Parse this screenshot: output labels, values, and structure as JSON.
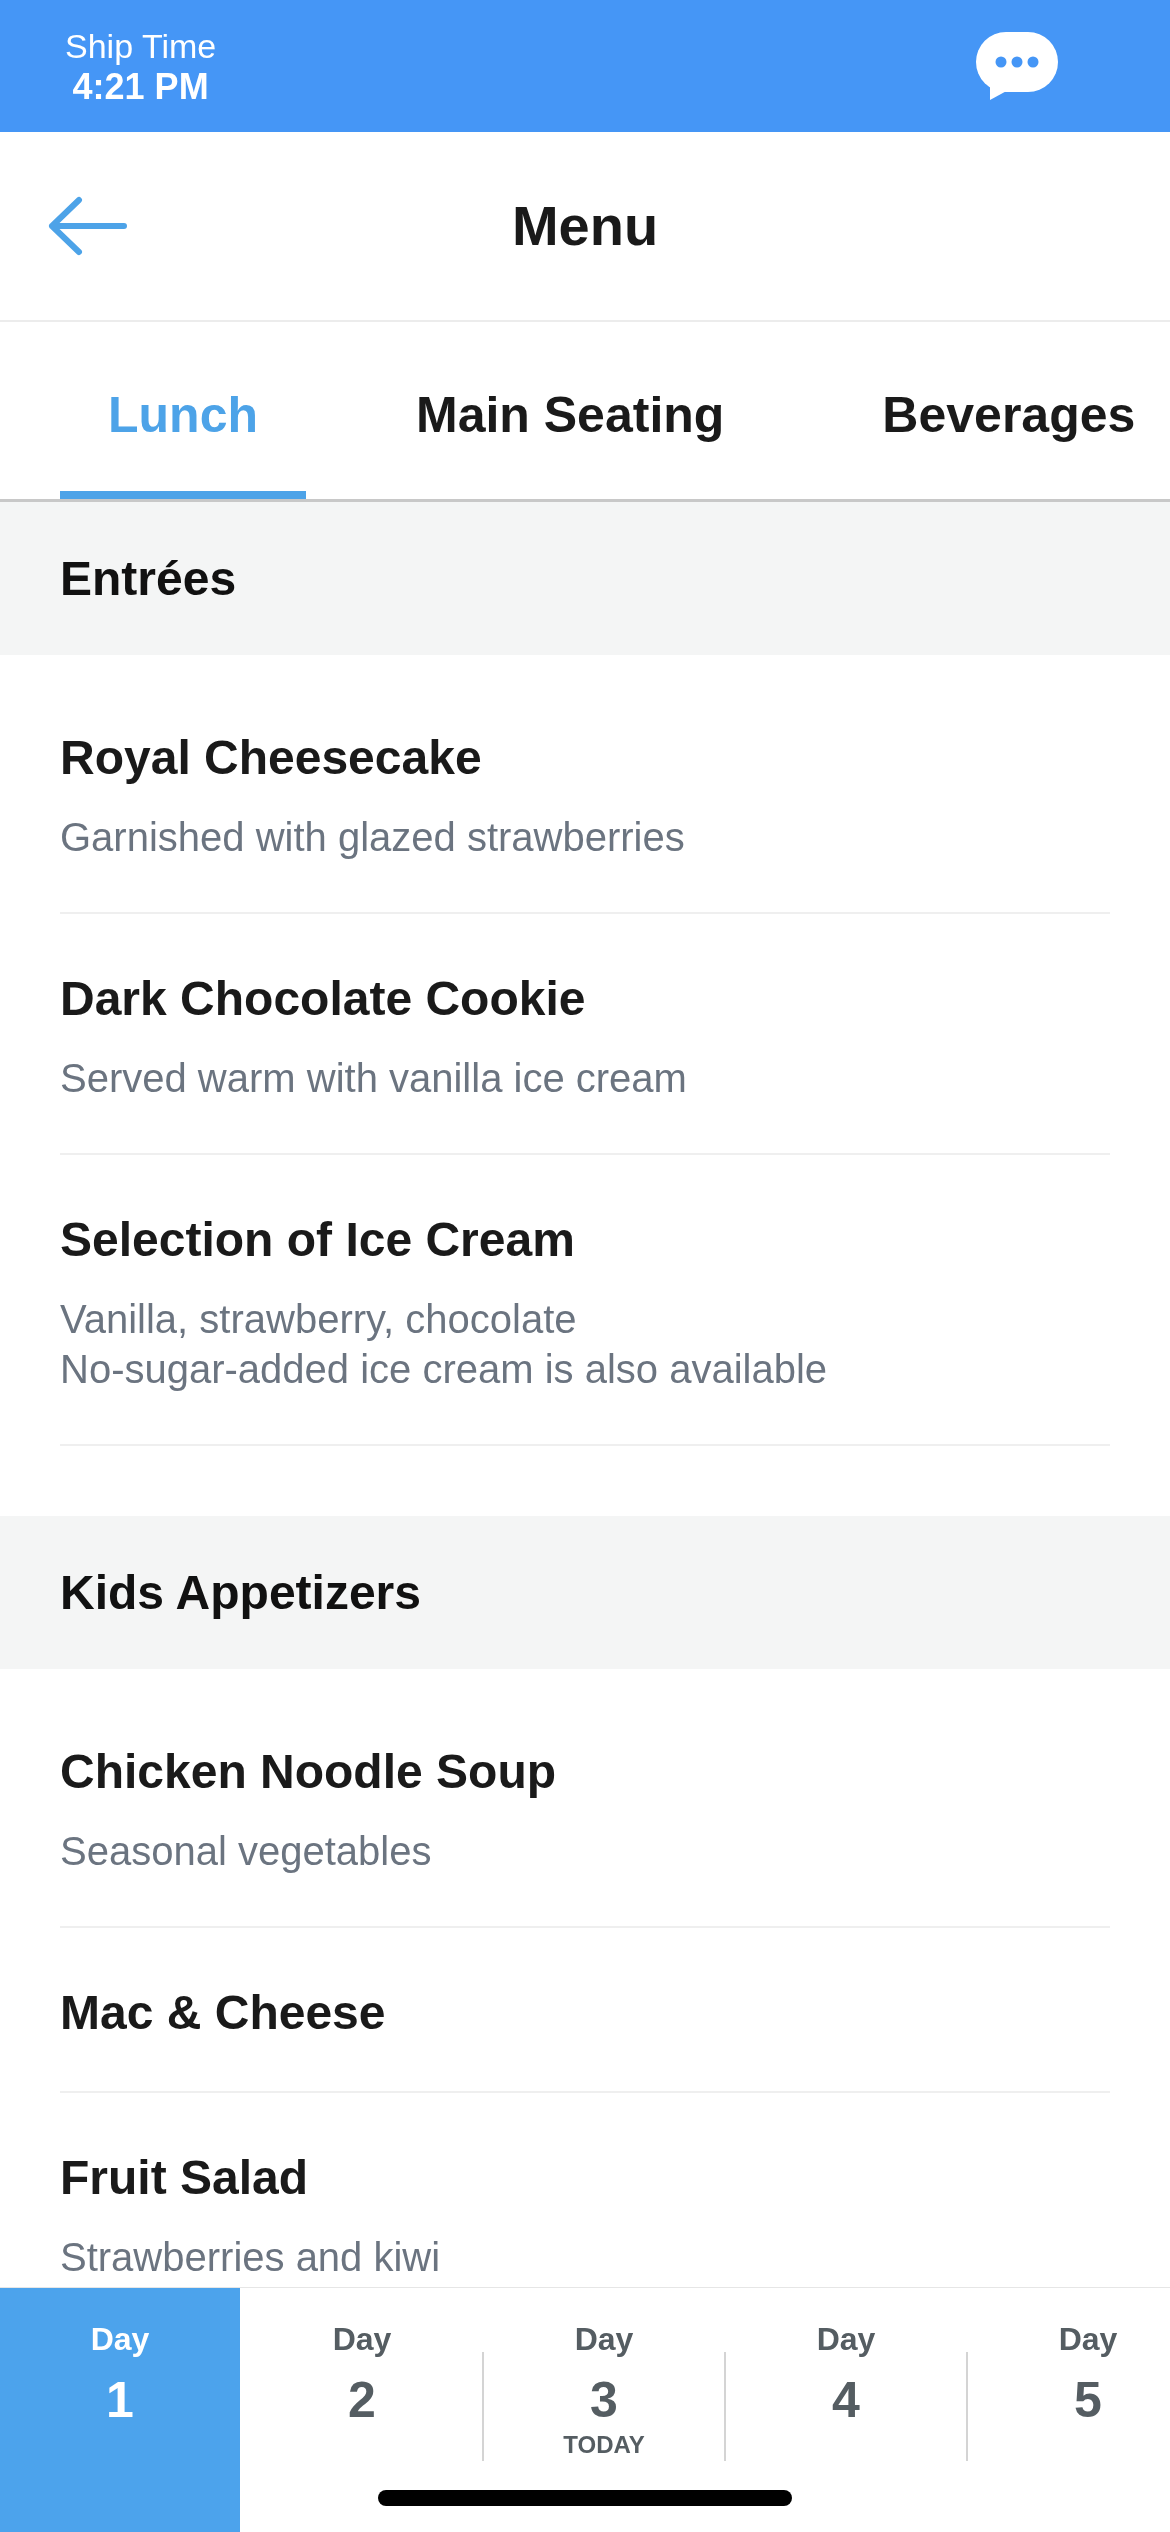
{
  "top_bar": {
    "label": "Ship Time",
    "time": "4:21 PM"
  },
  "header": {
    "title": "Menu"
  },
  "tabs": [
    {
      "label": "Lunch",
      "selected": true
    },
    {
      "label": "Main Seating",
      "selected": false
    },
    {
      "label": "Beverages",
      "selected": false
    }
  ],
  "sections": [
    {
      "title": "Entrées",
      "items": [
        {
          "name": "Royal Cheesecake",
          "description": [
            "Garnished with glazed strawberries"
          ]
        },
        {
          "name": "Dark Chocolate Cookie",
          "description": [
            "Served warm with vanilla ice cream"
          ]
        },
        {
          "name": "Selection of Ice Cream",
          "description": [
            "Vanilla, strawberry, chocolate",
            "No-sugar-added ice cream is also available"
          ]
        }
      ]
    },
    {
      "title": "Kids Appetizers",
      "items": [
        {
          "name": "Chicken Noodle Soup",
          "description": [
            "Seasonal vegetables"
          ]
        },
        {
          "name": "Mac & Cheese"
        },
        {
          "name": "Fruit Salad",
          "description": [
            "Strawberries and kiwi"
          ]
        }
      ]
    }
  ],
  "days": [
    {
      "label": "Day",
      "number": "1",
      "selected": true
    },
    {
      "label": "Day",
      "number": "2",
      "selected": false
    },
    {
      "label": "Day",
      "number": "3",
      "note": "TODAY",
      "selected": false
    },
    {
      "label": "Day",
      "number": "4",
      "selected": false
    },
    {
      "label": "Day",
      "number": "5",
      "selected": false
    }
  ]
}
